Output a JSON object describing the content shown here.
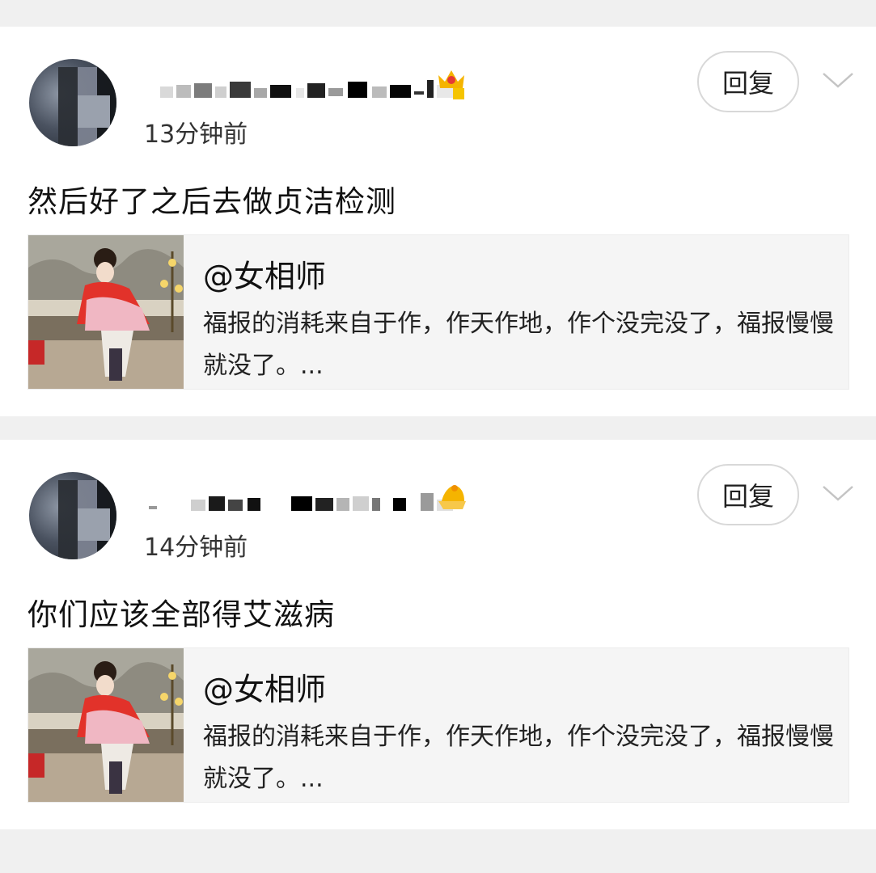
{
  "comments": [
    {
      "time": "13分钟前",
      "reply_label": "回复",
      "more_icon": "chevron-down-icon",
      "content": "然后好了之后去做贞洁检测",
      "quote": {
        "handle": "@女相师",
        "excerpt": "福报的消耗来自于作，作天作地，作个没完没了，福报慢慢就没了。..."
      }
    },
    {
      "time": "14分钟前",
      "reply_label": "回复",
      "more_icon": "chevron-down-icon",
      "content": "你们应该全部得艾滋病",
      "quote": {
        "handle": "@女相师",
        "excerpt": "福报的消耗来自于作，作天作地，作个没完没了，福报慢慢就没了。..."
      }
    }
  ],
  "colors": {
    "page_bg": "#f0f0f0",
    "card_bg": "#ffffff",
    "quote_bg": "#f5f5f5",
    "crown_gold": "#f5b400",
    "crown_red": "#e53935"
  }
}
